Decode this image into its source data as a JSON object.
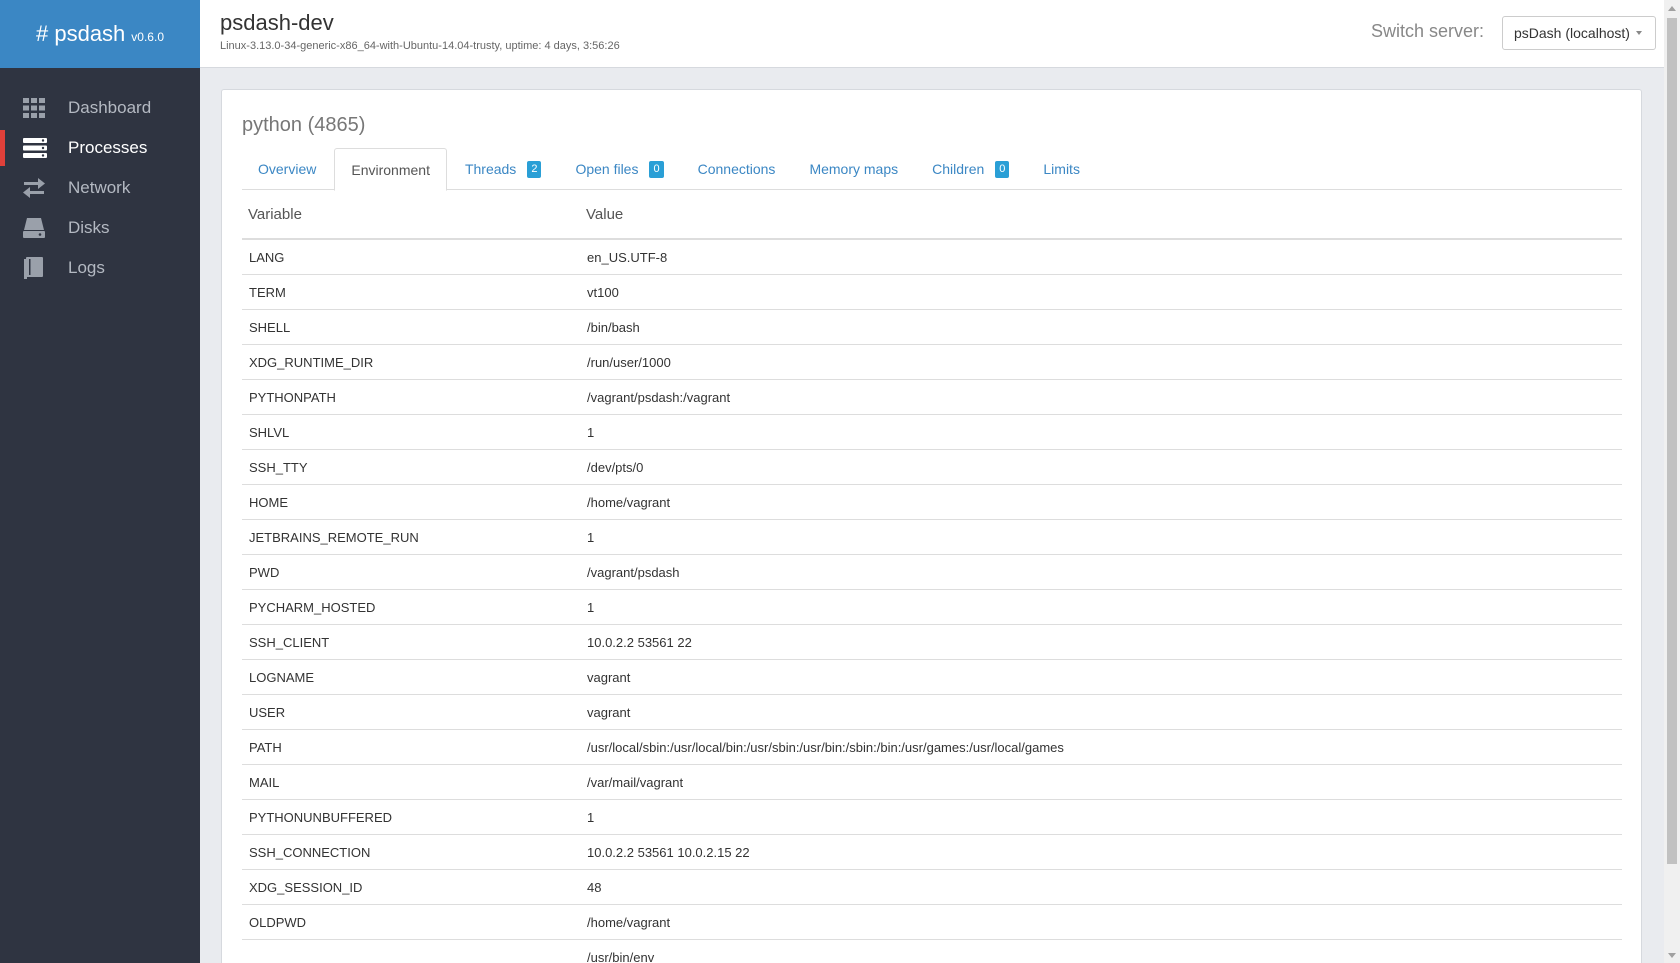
{
  "brand": {
    "name": "# psdash",
    "version": "v0.6.0"
  },
  "sidebar": {
    "items": [
      {
        "label": "Dashboard",
        "icon": "grid-icon",
        "active": false
      },
      {
        "label": "Processes",
        "icon": "server-icon",
        "active": true
      },
      {
        "label": "Network",
        "icon": "exchange-icon",
        "active": false
      },
      {
        "label": "Disks",
        "icon": "hdd-icon",
        "active": false
      },
      {
        "label": "Logs",
        "icon": "book-icon",
        "active": false
      }
    ]
  },
  "header": {
    "hostname": "psdash-dev",
    "info": "Linux-3.13.0-34-generic-x86_64-with-Ubuntu-14.04-trusty, uptime: 4 days, 3:56:26",
    "switch_label": "Switch server:",
    "switch_value": "psDash (localhost)"
  },
  "process": {
    "title": "python (4865)"
  },
  "tabs": [
    {
      "label": "Overview",
      "active": false,
      "badge": null
    },
    {
      "label": "Environment",
      "active": true,
      "badge": null
    },
    {
      "label": "Threads",
      "active": false,
      "badge": "2"
    },
    {
      "label": "Open files",
      "active": false,
      "badge": "0"
    },
    {
      "label": "Connections",
      "active": false,
      "badge": null
    },
    {
      "label": "Memory maps",
      "active": false,
      "badge": null
    },
    {
      "label": "Children",
      "active": false,
      "badge": "0"
    },
    {
      "label": "Limits",
      "active": false,
      "badge": null
    }
  ],
  "table": {
    "headers": {
      "variable": "Variable",
      "value": "Value"
    },
    "rows": [
      {
        "variable": "LANG",
        "value": "en_US.UTF-8"
      },
      {
        "variable": "TERM",
        "value": "vt100"
      },
      {
        "variable": "SHELL",
        "value": "/bin/bash"
      },
      {
        "variable": "XDG_RUNTIME_DIR",
        "value": "/run/user/1000"
      },
      {
        "variable": "PYTHONPATH",
        "value": "/vagrant/psdash:/vagrant"
      },
      {
        "variable": "SHLVL",
        "value": "1"
      },
      {
        "variable": "SSH_TTY",
        "value": "/dev/pts/0"
      },
      {
        "variable": "HOME",
        "value": "/home/vagrant"
      },
      {
        "variable": "JETBRAINS_REMOTE_RUN",
        "value": "1"
      },
      {
        "variable": "PWD",
        "value": "/vagrant/psdash"
      },
      {
        "variable": "PYCHARM_HOSTED",
        "value": "1"
      },
      {
        "variable": "SSH_CLIENT",
        "value": "10.0.2.2 53561 22"
      },
      {
        "variable": "LOGNAME",
        "value": "vagrant"
      },
      {
        "variable": "USER",
        "value": "vagrant"
      },
      {
        "variable": "PATH",
        "value": "/usr/local/sbin:/usr/local/bin:/usr/sbin:/usr/bin:/sbin:/bin:/usr/games:/usr/local/games"
      },
      {
        "variable": "MAIL",
        "value": "/var/mail/vagrant"
      },
      {
        "variable": "PYTHONUNBUFFERED",
        "value": "1"
      },
      {
        "variable": "SSH_CONNECTION",
        "value": "10.0.2.2 53561 10.0.2.15 22"
      },
      {
        "variable": "XDG_SESSION_ID",
        "value": "48"
      },
      {
        "variable": "OLDPWD",
        "value": "/home/vagrant"
      },
      {
        "variable": "",
        "value": "/usr/bin/env"
      }
    ]
  },
  "colors": {
    "sidebar_bg": "#2f3441",
    "brand_bg": "#3b87c4",
    "active_marker": "#e0403a",
    "link": "#3b87c4",
    "badge": "#2a9fd6"
  }
}
